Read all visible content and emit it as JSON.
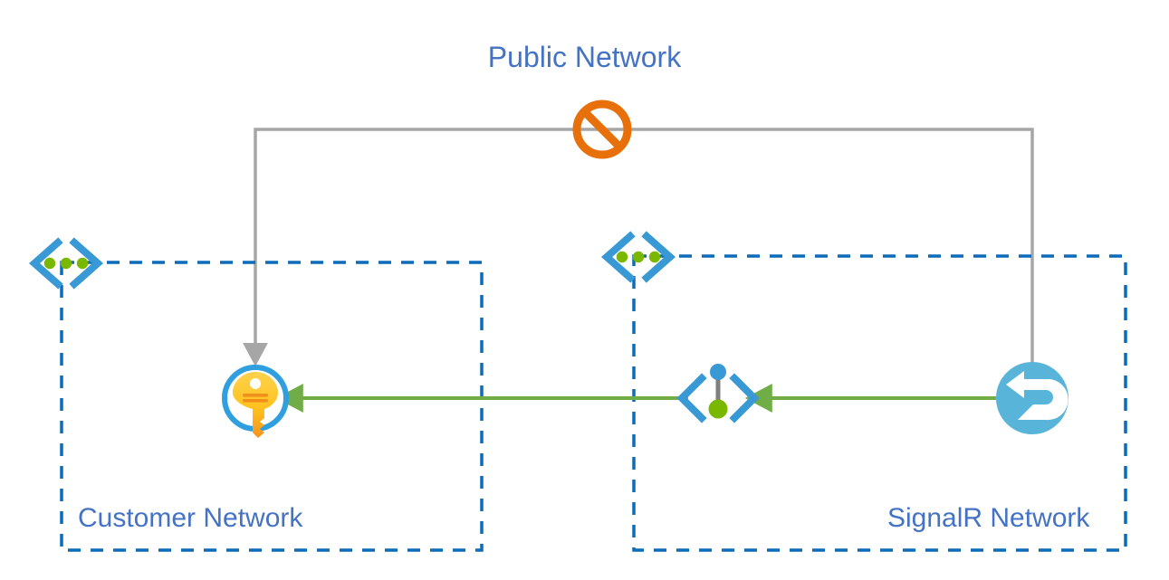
{
  "diagram": {
    "title": "Azure SignalR private endpoint network topology",
    "public_network": {
      "label": "Public Network",
      "label_color": "#4472c4",
      "blocked_icon": "no-entry-icon",
      "blocked_icon_color": "#e8700a",
      "line_color": "#a6a6a6"
    },
    "customer_network": {
      "label": "Customer Network",
      "label_color": "#3767b1",
      "border_color": "#0d6cb9",
      "border_style": "dashed",
      "vnet_icon": "virtual-network-icon",
      "resources": [
        {
          "name": "key-vault-icon",
          "label": "",
          "ring_color": "#2f9fe0",
          "key_color": "#ffb900"
        }
      ]
    },
    "signalr_network": {
      "label": "SignalR Network",
      "label_color": "#3767b1",
      "border_color": "#0d6cb9",
      "border_style": "dashed",
      "vnet_icon": "virtual-network-icon",
      "resources": [
        {
          "name": "private-endpoint-icon",
          "label": "",
          "bracket_color": "#3999d5",
          "top_dot_color": "#3999d5",
          "bottom_dot_color": "#7ab800"
        },
        {
          "name": "signalr-service-icon",
          "label": "",
          "circle_color": "#59b4d9",
          "glyph_color": "#ffffff"
        }
      ]
    },
    "connections": [
      {
        "name": "public-blocked-connection",
        "from": "signalr-service-icon",
        "to": "key-vault-icon",
        "via": "public-network",
        "color": "#a6a6a6",
        "arrow": "to-key-vault",
        "blocked": true
      },
      {
        "name": "private-endpoint-connection",
        "from": "signalr-service-icon",
        "to": "private-endpoint-icon",
        "color": "#70ad47",
        "arrow": "to-private-endpoint",
        "blocked": false
      },
      {
        "name": "private-key-vault-connection",
        "from": "private-endpoint-icon",
        "to": "key-vault-icon",
        "color": "#70ad47",
        "arrow": "to-key-vault",
        "blocked": false
      }
    ]
  }
}
